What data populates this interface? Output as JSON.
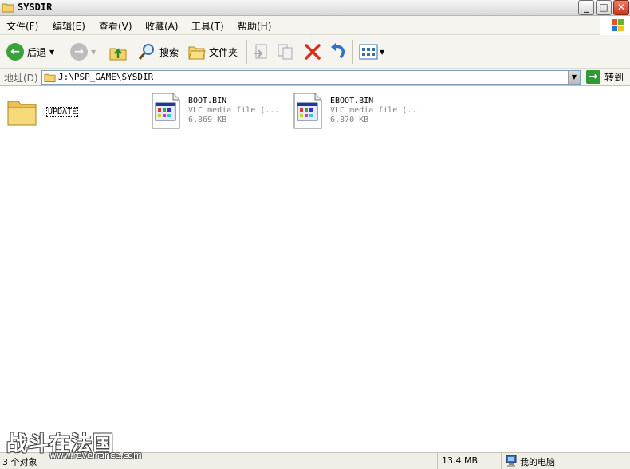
{
  "window": {
    "title": "SYSDIR",
    "minimize_label": "_",
    "maximize_label": "□",
    "close_label": "✕"
  },
  "menu": {
    "items": [
      "文件(F)",
      "编辑(E)",
      "查看(V)",
      "收藏(A)",
      "工具(T)",
      "帮助(H)"
    ]
  },
  "toolbar": {
    "back_label": "后退",
    "search_label": "搜索",
    "folders_label": "文件夹"
  },
  "address": {
    "label": "地址(D)",
    "path": "J:\\PSP_GAME\\SYSDIR",
    "go_label": "转到"
  },
  "files": [
    {
      "name": "UPDATE",
      "type": "folder"
    },
    {
      "name": "BOOT.BIN",
      "description": "VLC media file (...",
      "size": "6,869 KB"
    },
    {
      "name": "EBOOT.BIN",
      "description": "VLC media file (...",
      "size": "6,870 KB"
    }
  ],
  "statusbar": {
    "count": "3 个对象",
    "size": "13.4 MB",
    "location": "我的电脑"
  },
  "watermark": {
    "title": "战斗在法国",
    "url": "www.revefrance.com"
  }
}
